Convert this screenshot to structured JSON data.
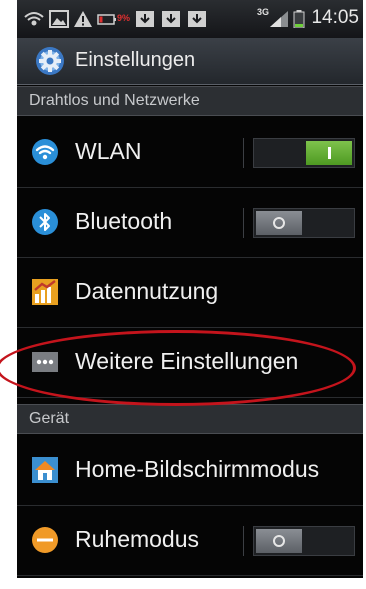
{
  "status_bar": {
    "battery_percent_icon": "9%",
    "network": "3G",
    "time": "14:05",
    "icons": [
      "wifi-tether-icon",
      "image-icon",
      "warning-icon",
      "download-icon",
      "download-icon",
      "download-icon",
      "signal-icon",
      "battery-icon"
    ]
  },
  "action_bar": {
    "title": "Einstellungen",
    "icon": "settings-gear-icon"
  },
  "sections": [
    {
      "title": "Drahtlos und Netzwerke",
      "items": [
        {
          "label": "WLAN",
          "icon": "wifi-icon",
          "toggle": "on"
        },
        {
          "label": "Bluetooth",
          "icon": "bluetooth-icon",
          "toggle": "off"
        },
        {
          "label": "Datennutzung",
          "icon": "data-usage-icon"
        },
        {
          "label": "Weitere Einstellungen",
          "icon": "more-icon",
          "highlighted": true
        }
      ]
    },
    {
      "title": "Gerät",
      "items": [
        {
          "label": "Home-Bildschirmmodus",
          "icon": "home-icon"
        },
        {
          "label": "Ruhemodus",
          "icon": "sleep-mode-icon",
          "toggle": "off"
        }
      ]
    }
  ],
  "colors": {
    "highlight_ellipse": "#c4141c",
    "toggle_on": "#5aa82a",
    "background": "#050505"
  }
}
